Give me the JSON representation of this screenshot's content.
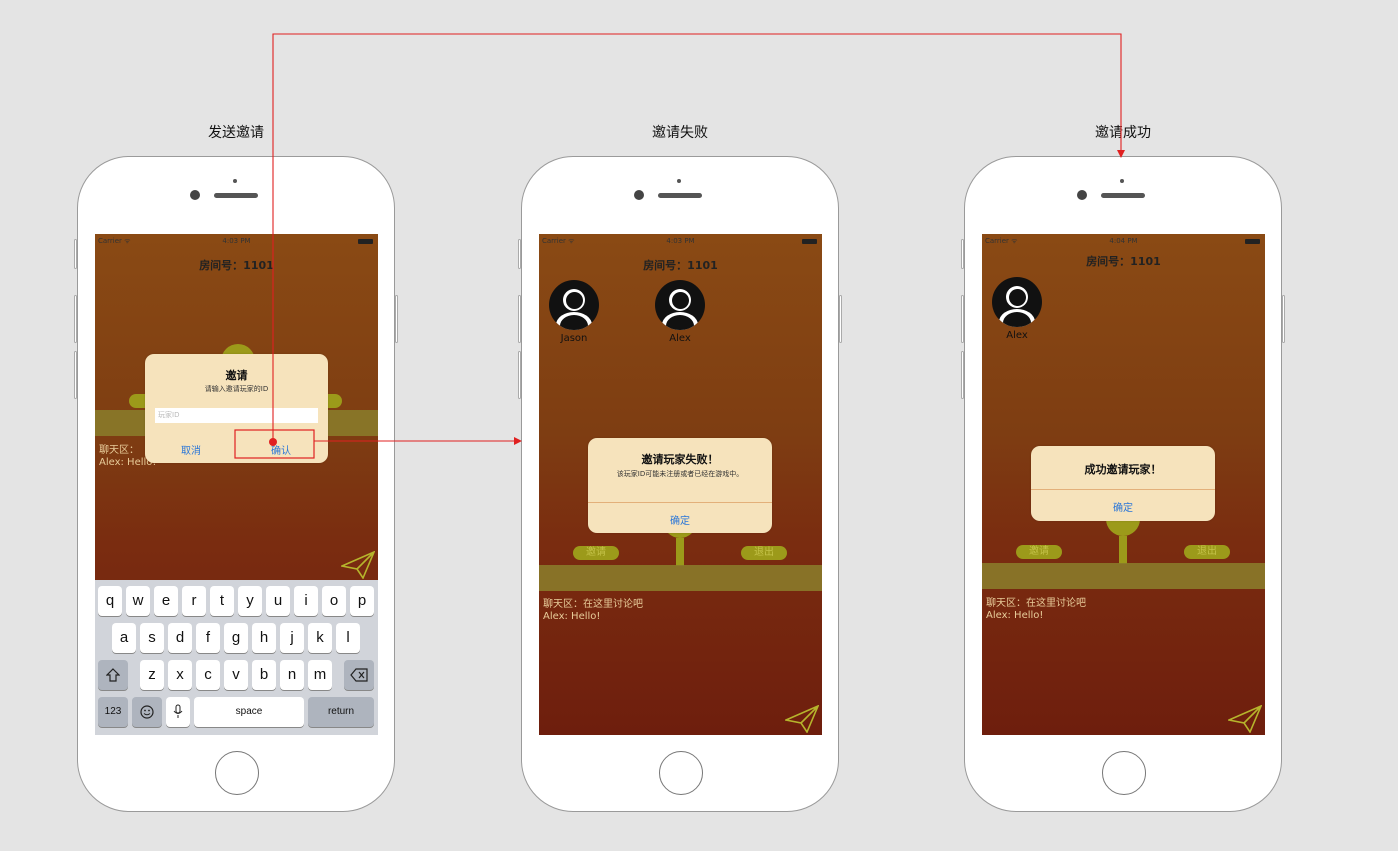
{
  "titles": {
    "s1": "发送邀请",
    "s2": "邀请失败",
    "s3": "邀请成功"
  },
  "status": {
    "carrier": "Carrier ᯤ",
    "time_s1": "4:03 PM",
    "time_s2": "4:03 PM",
    "time_s3": "4:04 PM"
  },
  "room": "房间号：1101",
  "players": {
    "jason": "Jason",
    "alex": "Alex"
  },
  "buttons": {
    "invite": "邀请",
    "exit": "退出"
  },
  "chat": {
    "header": "聊天区：在这里讨论吧",
    "header_partial": "聊天区：",
    "message": "Alex: Hello!"
  },
  "invite_dialog": {
    "title": "邀请",
    "message": "请输入邀请玩家的ID",
    "placeholder": "玩家ID",
    "cancel": "取消",
    "confirm": "确认"
  },
  "fail_dialog": {
    "title": "邀请玩家失败！",
    "message": "该玩家ID可能未注册或者已经在游戏中。",
    "ok": "确定"
  },
  "success_dialog": {
    "title": "成功邀请玩家！",
    "ok": "确定"
  },
  "keyboard": {
    "row1": [
      "q",
      "w",
      "e",
      "r",
      "t",
      "y",
      "u",
      "i",
      "o",
      "p"
    ],
    "row2": [
      "a",
      "s",
      "d",
      "f",
      "g",
      "h",
      "j",
      "k",
      "l"
    ],
    "row3": [
      "z",
      "x",
      "c",
      "v",
      "b",
      "n",
      "m"
    ],
    "numbers": "123",
    "space": "space",
    "return": "return"
  },
  "colors": {
    "flow_arrow": "#e02020",
    "dialog_bg": "#f6e3bc",
    "button_blue": "#2a76d8"
  }
}
